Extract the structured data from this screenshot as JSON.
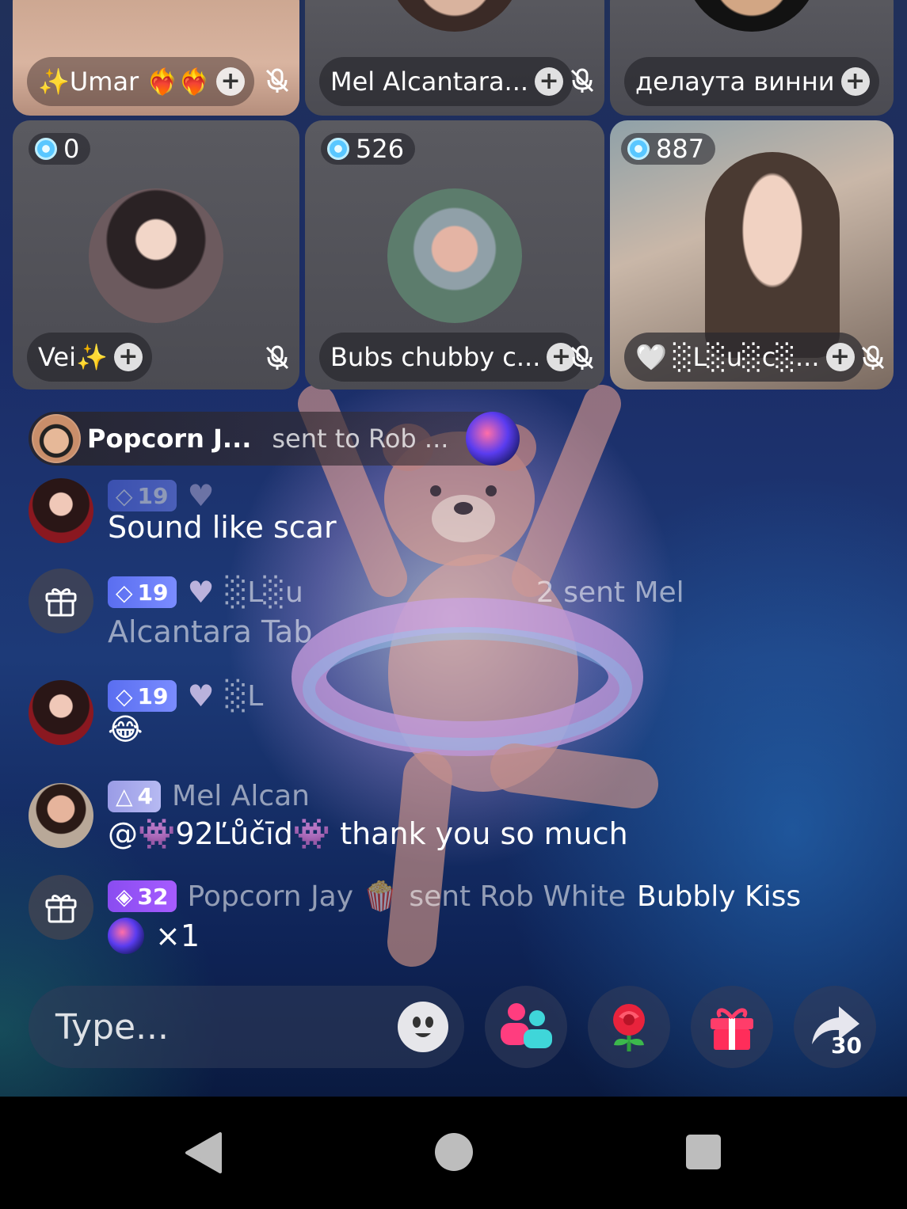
{
  "seats_top": [
    {
      "name": "✨Umar ❤️‍🔥❤️‍🔥"
    },
    {
      "name": "Mel Alcantara..."
    },
    {
      "name": "делаута винни"
    }
  ],
  "seats_mid": [
    {
      "score": "0",
      "name": "Vei✨"
    },
    {
      "score": "526",
      "name": "Bubs chubby c..."
    },
    {
      "score": "887",
      "name": "░L░u░c░...",
      "badge": "🤍"
    }
  ],
  "gift_banner": {
    "sender": "Popcorn J...",
    "text": "sent to Rob ..."
  },
  "chat": [
    {
      "level": "19",
      "message": "Sound like scar"
    },
    {
      "level": "19",
      "name": "░L░u",
      "text_a": "2 sent Mel",
      "text_b": "Alcantara Tab"
    },
    {
      "level": "19",
      "name": "░L",
      "message": "😂"
    },
    {
      "level": "4",
      "name": "Mel Alcan",
      "message": "@👾92Ľůčīd👾 thank you so much"
    },
    {
      "level": "32",
      "name": "Popcorn Jay 🍿",
      "text": "sent Rob White",
      "gift_name": "Bubbly Kiss",
      "count": "×1"
    }
  ],
  "input": {
    "placeholder": "Type..."
  },
  "share_count": "30",
  "colors": {
    "accent_pink": "#ff3d7f",
    "level_blue": "#6a7cf6",
    "level_purple": "#9a52f4"
  }
}
